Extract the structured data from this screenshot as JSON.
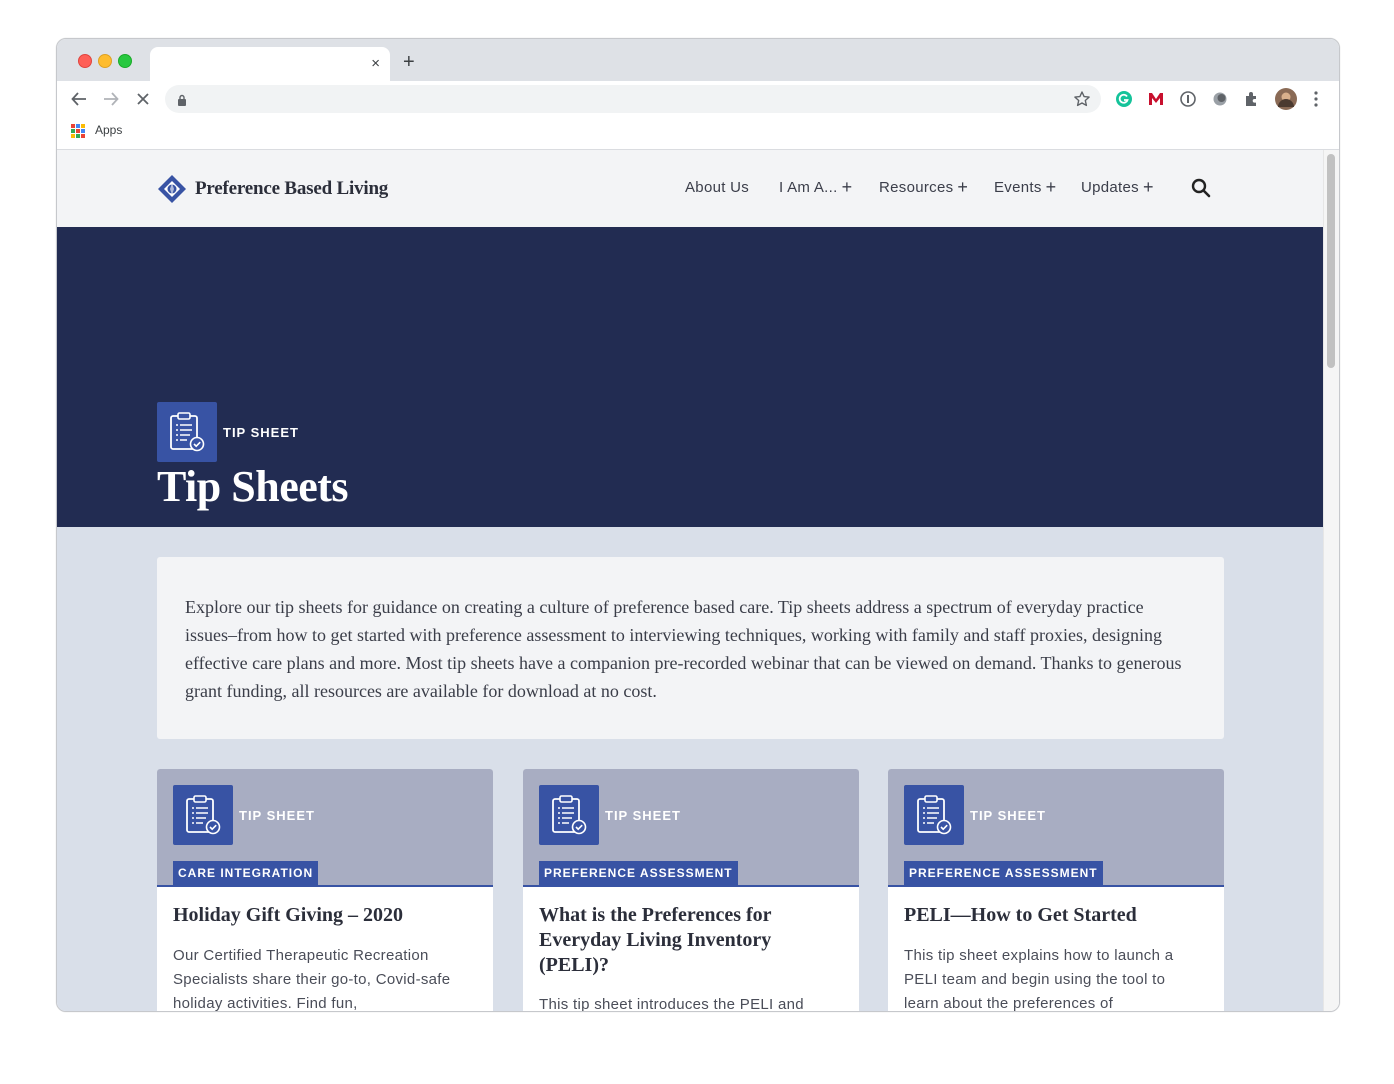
{
  "browser": {
    "tab_title": "",
    "tab_close": "×",
    "new_tab": "+",
    "url": "",
    "bookmarks": {
      "apps_label": "Apps"
    }
  },
  "site": {
    "logo_text": "Preference Based Living",
    "menu": [
      {
        "label": "About Us",
        "has_submenu": false
      },
      {
        "label": "I Am A...",
        "has_submenu": true
      },
      {
        "label": "Resources",
        "has_submenu": true
      },
      {
        "label": "Events",
        "has_submenu": true
      },
      {
        "label": "Updates",
        "has_submenu": true
      }
    ],
    "plus": "+"
  },
  "hero": {
    "type_label": "TIP SHEET",
    "title": "Tip Sheets"
  },
  "intro": {
    "text": "Explore our tip sheets for guidance on creating a culture of preference based care. Tip sheets address a spectrum of everyday practice issues–from how to get started with preference assessment to interviewing techniques, working with family and staff proxies, designing effective care plans and more. Most tip sheets have a companion pre-recorded webinar that can be viewed on demand. Thanks to generous grant funding, all resources are available for download at no cost."
  },
  "cards": [
    {
      "type_label": "TIP SHEET",
      "category": "CARE INTEGRATION",
      "title": "Holiday Gift Giving – 2020",
      "description": "Our Certified Therapeutic Recreation Specialists share their go-to, Covid-safe holiday activities. Find fun,"
    },
    {
      "type_label": "TIP SHEET",
      "category": "PREFERENCE ASSESSMENT",
      "title": "What is the Preferences for Everyday Living Inventory (PELI)?",
      "description": "This tip sheet introduces the PELI and"
    },
    {
      "type_label": "TIP SHEET",
      "category": "PREFERENCE ASSESSMENT",
      "title": "PELI—How to Get Started",
      "description": "This tip sheet explains how to launch a PELI team and begin using the tool to learn about the preferences of"
    }
  ],
  "colors": {
    "hero_bg": "#222c52",
    "accent_blue": "#3853a4",
    "page_bg": "#d9dfe9",
    "card_head": "#a8adc2"
  }
}
